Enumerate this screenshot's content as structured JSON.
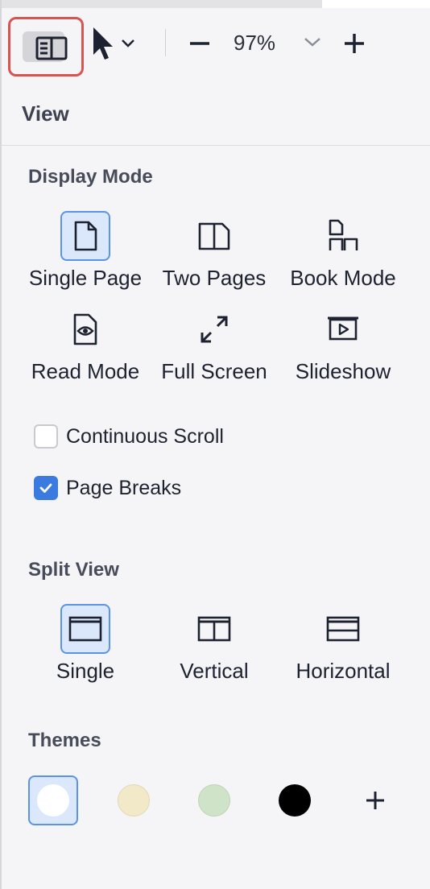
{
  "toolbar": {
    "zoom_value": "97%"
  },
  "panel": {
    "title": "View",
    "display_mode": {
      "title": "Display Mode",
      "options": [
        {
          "label": "Single Page",
          "icon": "single-page-icon",
          "selected": true
        },
        {
          "label": "Two Pages",
          "icon": "two-pages-icon",
          "selected": false
        },
        {
          "label": "Book Mode",
          "icon": "book-mode-icon",
          "selected": false
        },
        {
          "label": "Read Mode",
          "icon": "read-mode-icon",
          "selected": false
        },
        {
          "label": "Full Screen",
          "icon": "full-screen-icon",
          "selected": false
        },
        {
          "label": "Slideshow",
          "icon": "slideshow-icon",
          "selected": false
        }
      ]
    },
    "checkboxes": [
      {
        "label": "Continuous Scroll",
        "checked": false
      },
      {
        "label": "Page Breaks",
        "checked": true
      }
    ],
    "split_view": {
      "title": "Split View",
      "options": [
        {
          "label": "Single",
          "icon": "split-single-icon",
          "selected": true
        },
        {
          "label": "Vertical",
          "icon": "split-vertical-icon",
          "selected": false
        },
        {
          "label": "Horizontal",
          "icon": "split-horizontal-icon",
          "selected": false
        }
      ]
    },
    "themes": {
      "title": "Themes",
      "swatches": [
        {
          "name": "white",
          "color": "#ffffff",
          "selected": true
        },
        {
          "name": "sepia",
          "color": "#f2e9c9",
          "selected": false
        },
        {
          "name": "green",
          "color": "#cfe3c9",
          "selected": false
        },
        {
          "name": "black",
          "color": "#000000",
          "selected": false
        }
      ],
      "add_icon": "plus-icon"
    }
  },
  "colors": {
    "accent": "#3b7be0",
    "selected_bg": "#dbe8fb",
    "highlight_border": "#d9534f"
  }
}
